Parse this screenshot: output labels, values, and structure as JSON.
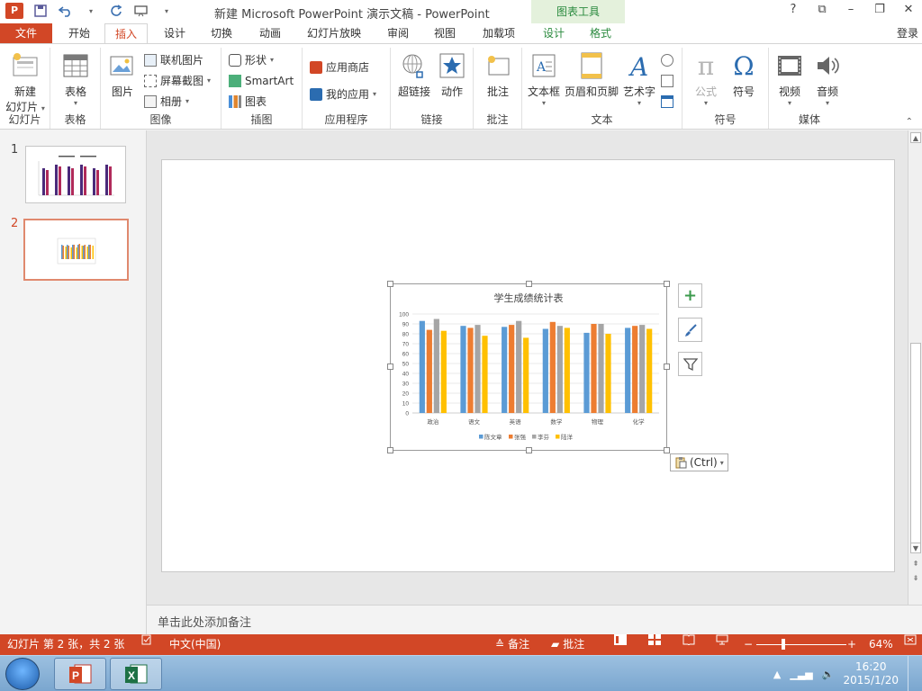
{
  "titlebar": {
    "logo": "P",
    "title": "新建 Microsoft PowerPoint 演示文稿 - PowerPoint",
    "context_tab": "图表工具",
    "help": "?",
    "ribbon_display": "⧉",
    "minimize": "–",
    "maximize": "❐",
    "close": "✕"
  },
  "tabs": {
    "file": "文件",
    "home": "开始",
    "insert": "插入",
    "design": "设计",
    "transitions": "切换",
    "animations": "动画",
    "slideshow": "幻灯片放映",
    "review": "审阅",
    "view": "视图",
    "addins": "加载项",
    "chart_design": "设计",
    "chart_format": "格式",
    "login": "登录"
  },
  "ribbon": {
    "new_slide_1": "新建",
    "new_slide_2": "幻灯片",
    "group_slides": "幻灯片",
    "table": "表格",
    "group_table": "表格",
    "picture": "图片",
    "online_picture": "联机图片",
    "screenshot": "屏幕截图",
    "album": "相册",
    "group_images": "图像",
    "shapes": "形状",
    "smartart": "SmartArt",
    "chart": "图表",
    "group_illustrations": "插图",
    "store": "应用商店",
    "my_apps": "我的应用",
    "group_apps": "应用程序",
    "hyperlink": "超链接",
    "action": "动作",
    "group_links": "链接",
    "comment": "批注",
    "group_comments": "批注",
    "textbox": "文本框",
    "header_footer": "页眉和页脚",
    "wordart": "艺术字",
    "group_text": "文本",
    "equation": "公式",
    "symbol": "符号",
    "group_symbols": "符号",
    "video": "视频",
    "audio": "音频",
    "group_media": "媒体"
  },
  "slides": {
    "num1": "1",
    "num2": "2"
  },
  "paste_tag": "(Ctrl)",
  "notes_placeholder": "单击此处添加备注",
  "status": {
    "slide_info": "幻灯片 第 2 张，共 2 张",
    "language": "中文(中国)",
    "notes": "备注",
    "comments": "批注",
    "zoom": "64%",
    "zoom_value": 64
  },
  "taskbar": {
    "time": "16:20",
    "date": "2015/1/20"
  },
  "chart_data": {
    "type": "bar",
    "title": "学生成绩统计表",
    "categories": [
      "政治",
      "语文",
      "英语",
      "数学",
      "物理",
      "化学"
    ],
    "series": [
      {
        "name": "陈文章",
        "color": "#5b9bd5",
        "values": [
          93,
          88,
          87,
          85,
          81,
          86
        ]
      },
      {
        "name": "张强",
        "color": "#ed7d31",
        "values": [
          84,
          86,
          89,
          92,
          90,
          88
        ]
      },
      {
        "name": "李芬",
        "color": "#a5a5a5",
        "values": [
          95,
          89,
          93,
          88,
          90,
          89
        ]
      },
      {
        "name": "陆洋",
        "color": "#ffc000",
        "values": [
          83,
          78,
          76,
          86,
          80,
          85
        ]
      }
    ],
    "ylim": [
      0,
      100
    ],
    "yticks": [
      0,
      10,
      20,
      30,
      40,
      50,
      60,
      70,
      80,
      90,
      100
    ],
    "grid": true,
    "legend": "bottom"
  }
}
